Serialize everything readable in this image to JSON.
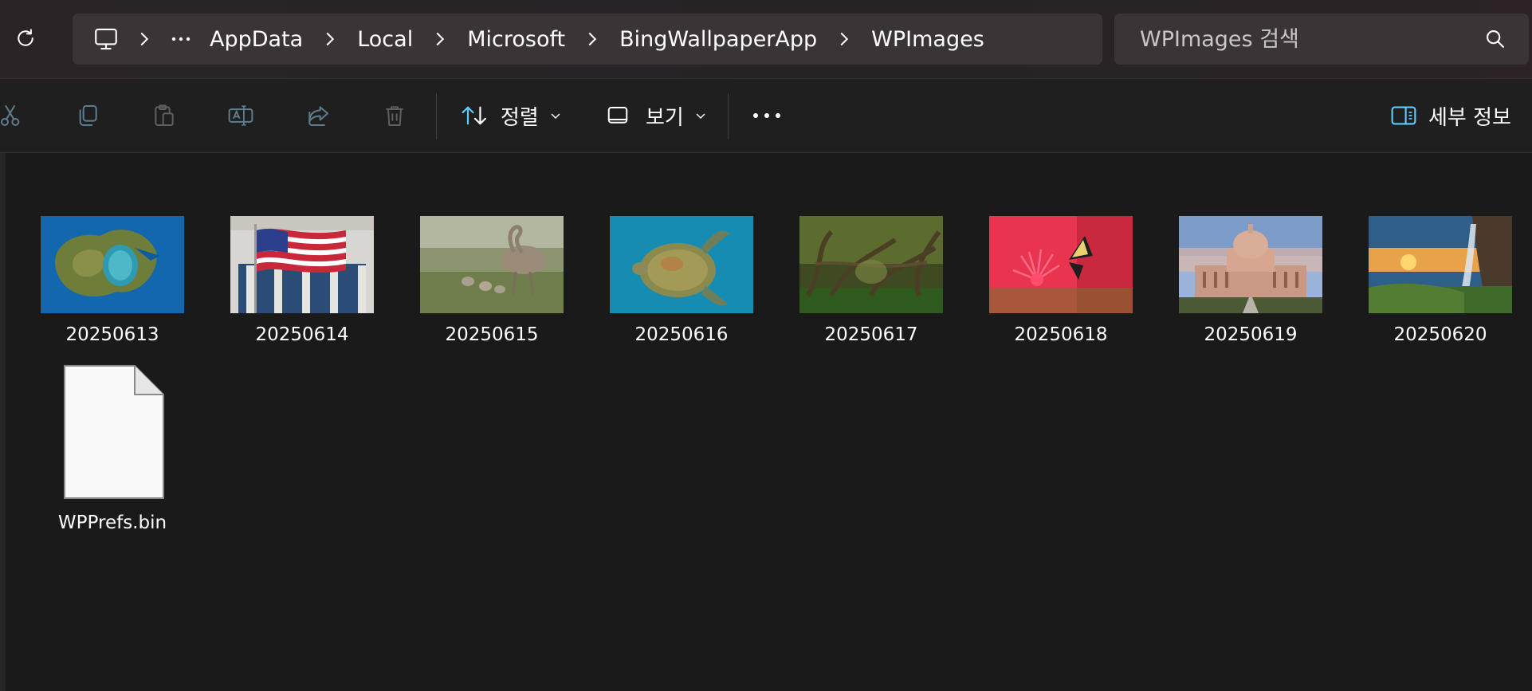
{
  "breadcrumb": {
    "items": [
      "AppData",
      "Local",
      "Microsoft",
      "BingWallpaperApp",
      "WPImages"
    ]
  },
  "search": {
    "placeholder": "WPImages 검색"
  },
  "commandbar": {
    "sort_label": "정렬",
    "view_label": "보기",
    "details_label": "세부 정보"
  },
  "files": [
    {
      "name": "20250613",
      "thumb": "island"
    },
    {
      "name": "20250614",
      "thumb": "flag"
    },
    {
      "name": "20250615",
      "thumb": "rhea"
    },
    {
      "name": "20250616",
      "thumb": "turtle"
    },
    {
      "name": "20250617",
      "thumb": "trees"
    },
    {
      "name": "20250618",
      "thumb": "butterfly"
    },
    {
      "name": "20250619",
      "thumb": "capitol"
    },
    {
      "name": "20250620",
      "thumb": "waterfall"
    },
    {
      "name": "WPPrefs.bin",
      "thumb": "generic-file"
    }
  ],
  "colors": {
    "accent": "#60cdff",
    "background": "#1a1a1a",
    "bar": "#3a3436"
  }
}
